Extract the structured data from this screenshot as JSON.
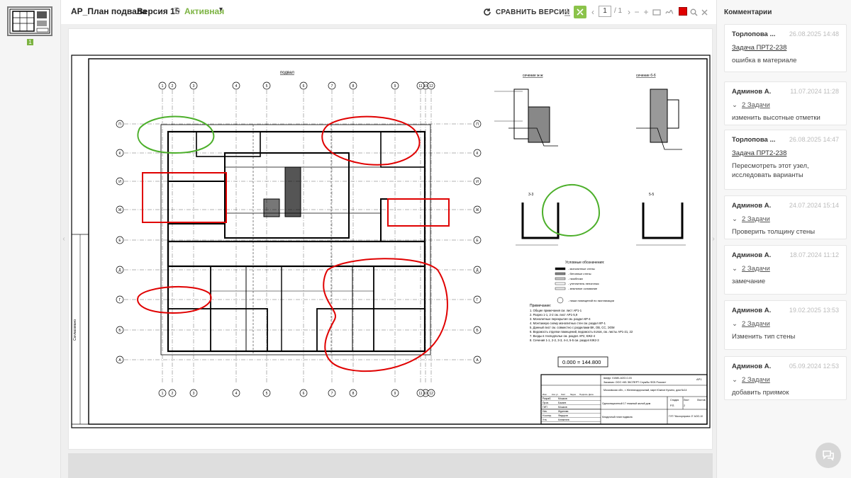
{
  "header": {
    "doc_title": "АР_План подвала",
    "version_label": "Версия 15",
    "status": "Активная",
    "compare_label": "СРАВНИТЬ ВЕРСИИ"
  },
  "pager": {
    "current": "1",
    "total": "/ 1"
  },
  "thumbnail": {
    "page_number": "1"
  },
  "annotation_color": "#e00000",
  "drawing": {
    "title": "подвал",
    "section_top_left": "сечение ж-ж",
    "section_top_right": "сечение б-б",
    "section_mid_left": "3-3",
    "section_mid_right": "5-5",
    "legend_title": "Условные обозначения:",
    "legend_items": [
      "- монолитные стены",
      "- бетонные стены",
      "- газоблоки",
      "- утеплитель пеноплэкс",
      "- земляное основание",
      "- ниши помещений по экспликации"
    ],
    "notes_title": "Примечание:",
    "notes": [
      "1. Общие примечания см. лист АР1-1",
      "2. Разрез 1-1, 2-2 см. лист АР1-5,9",
      "3. Монолитные перекрытия см. раздел КР-4",
      "4. Монтажную схему монолитных стен см. раздел КР-1",
      "5. Данный лист см. совместно с разделами ВК, ОВ, СС, ЭОМ",
      "6. Ведомость отделки помещений, ведомость полов, см. листы АР1-21, 22",
      "7. Входы в техподполье см. раздел АР2, КЖ2-4",
      "8. Сечения 1-1, 2-2, 3-3, 4-4, 5-5 см. раздел КЖ2-3"
    ],
    "level_mark": "0.000 = 144.800",
    "col_axes": [
      "1",
      "2",
      "3",
      "4",
      "5",
      "6",
      "7",
      "8",
      "9",
      "10",
      "11",
      "12"
    ],
    "row_axes": [
      "П",
      "К",
      "И",
      "Ж",
      "Е",
      "Д",
      "Г",
      "Б",
      "А"
    ],
    "stamp": {
      "code": "Шифр: 01580-АОО-0-03",
      "customer": "Заказчик: ООО «КБ ЭКСПЕРТ Службы ФСБ России»",
      "address": "Московская обл., г. Железнодорожный, мкрн Южное Кучино, дом №14",
      "building": "Односекционный 17 этажный жилой дом",
      "sheet_name": "Кладочный план подвала",
      "org": "ГУП \"Мосгорпроект-3\" АОО-10",
      "stage_header": [
        "Стадия",
        "Лист",
        "Листов"
      ],
      "stage_values": [
        "Р.П.",
        "2",
        ""
      ],
      "sheet_code": "АР1",
      "roles": [
        "Изм.",
        "Кол.уч",
        "Лист",
        "№док",
        "Подпись",
        "Дата"
      ],
      "people": [
        [
          "Разраб.",
          "Мошков"
        ],
        [
          "Пров.",
          "Бакаев"
        ],
        [
          "ГИП",
          "Мошков"
        ],
        [
          "Нач.",
          "Жданова"
        ],
        [
          "Н.контр.",
          "Федоров"
        ],
        [
          "Утв.",
          "Клеменев"
        ]
      ]
    },
    "side_label": "Согласовано"
  },
  "comments": {
    "title": "Комментарии",
    "items": [
      {
        "author": "Торлопова ...",
        "date": "26.08.2025 14:48",
        "task": "Задача ПРТ2-238",
        "text": "ошибка в материале"
      },
      {
        "author": "Админов А.",
        "date": "11.07.2024 11:28",
        "tasks": "2 Задачи",
        "text": "изменить высотные отметки"
      },
      {
        "author": "Торлопова ...",
        "date": "26.08.2025 14:47",
        "task": "Задача ПРТ2-238",
        "text": "Пересмотреть этот узел, исследовать варианты"
      },
      {
        "author": "Админов А.",
        "date": "24.07.2024 15:14",
        "tasks": "2 Задачи",
        "text": "Проверить толщину стены"
      },
      {
        "author": "Админов А.",
        "date": "18.07.2024 11:12",
        "tasks": "2 Задачи",
        "text": "замечание"
      },
      {
        "author": "Админов А.",
        "date": "19.02.2025 13:53",
        "tasks": "2 Задачи",
        "text": "Изменить тип стены"
      },
      {
        "author": "Админов А.",
        "date": "05.09.2024 12:53",
        "tasks": "2 Задачи",
        "text": "добавить приямок"
      }
    ]
  }
}
